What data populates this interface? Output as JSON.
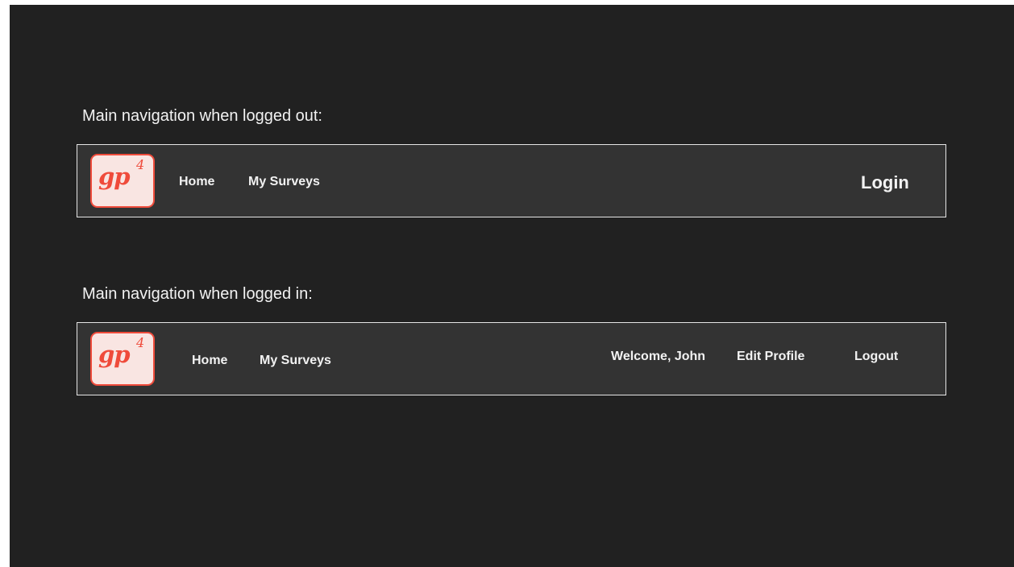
{
  "section_logged_out": {
    "title": "Main navigation when logged out:",
    "logo": {
      "text": "gp",
      "superscript": "4"
    },
    "links": {
      "home": "Home",
      "my_surveys": "My Surveys"
    },
    "login": "Login"
  },
  "section_logged_in": {
    "title": "Main navigation when logged in:",
    "logo": {
      "text": "gp",
      "superscript": "4"
    },
    "links": {
      "home": "Home",
      "my_surveys": "My Surveys"
    },
    "welcome": "Welcome, John",
    "edit_profile": "Edit Profile",
    "logout": "Logout"
  },
  "colors": {
    "background": "#212121",
    "navbar": "#333333",
    "navbar_border": "#e6e6e6",
    "logo_fill": "#f9e5e2",
    "logo_accent": "#ef4b3b",
    "text": "#f2f2f2"
  }
}
